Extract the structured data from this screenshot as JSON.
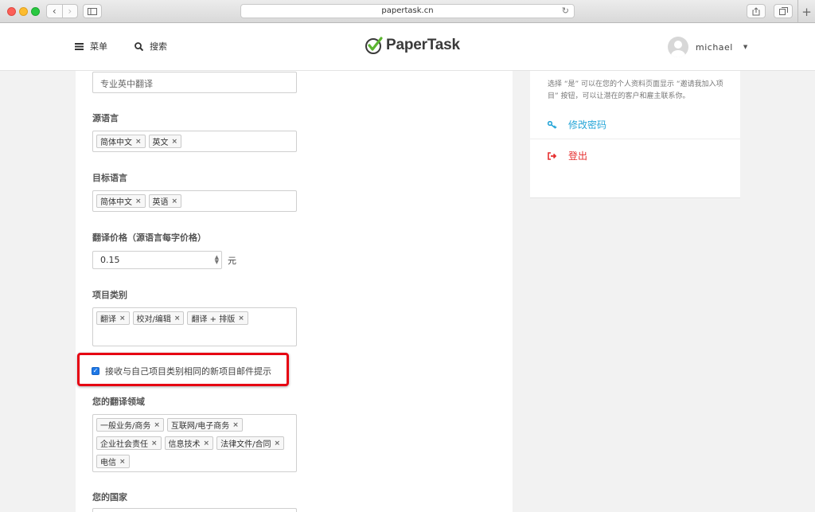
{
  "browser": {
    "url": "papertask.cn",
    "reload_glyph": "↻",
    "back_glyph": "‹",
    "forward_glyph": "›",
    "new_tab_glyph": "+"
  },
  "header": {
    "menu_label": "菜单",
    "search_label": "搜索",
    "logo_text": "PaperTask",
    "username": "michael"
  },
  "form": {
    "title_value": "专业英中翻译",
    "source_language": {
      "label": "源语言",
      "tags": [
        "简体中文",
        "英文"
      ]
    },
    "target_language": {
      "label": "目标语言",
      "tags": [
        "简体中文",
        "英语"
      ]
    },
    "price": {
      "label": "翻译价格（源语言每字价格）",
      "value": "0.15",
      "unit": "元"
    },
    "project_category": {
      "label": "项目类别",
      "tags": [
        "翻译",
        "校对/编辑",
        "翻译 + 排版"
      ]
    },
    "email_notify": {
      "label": "接收与自己项目类别相同的新项目邮件提示",
      "checked": true
    },
    "domains": {
      "label": "您的翻译领域",
      "tags": [
        "一般业务/商务",
        "互联网/电子商务",
        "企业社会责任",
        "信息技术",
        "法律文件/合同",
        "电信"
      ]
    },
    "country": {
      "label": "您的国家"
    },
    "tag_remove_glyph": "×"
  },
  "sidebar": {
    "help_text": "选择 “是” 可以在您的个人资料页面显示 “邀请我加入项目” 按钮，可以让潜在的客户和雇主联系你。",
    "change_password": "修改密码",
    "logout": "登出"
  },
  "colors": {
    "accent_blue": "#27a6d8",
    "logout_red": "#e62e2e",
    "highlight_red": "#e60012",
    "checkbox_blue": "#1e78e6",
    "logo_green": "#5cb531"
  }
}
